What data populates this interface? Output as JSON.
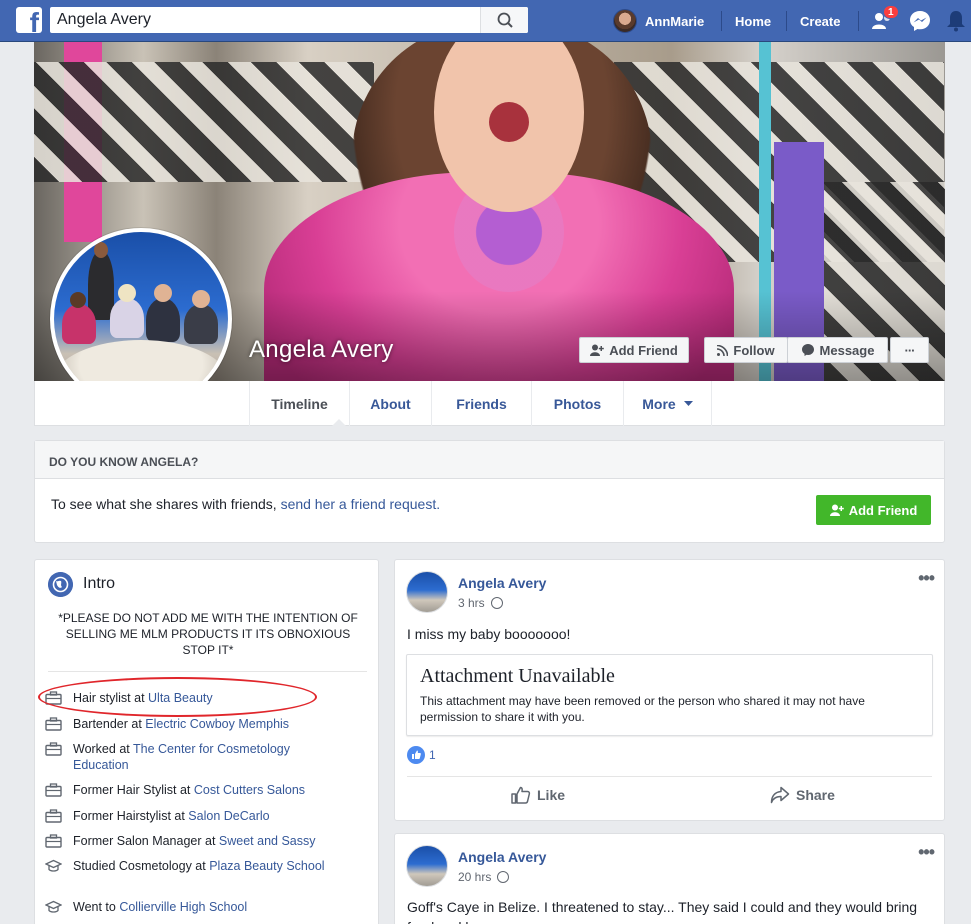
{
  "topbar": {
    "search_value": "Angela Avery",
    "user_name": "AnnMarie",
    "home": "Home",
    "create": "Create",
    "friend_requests_count": "1"
  },
  "profile": {
    "name": "Angela Avery",
    "buttons": {
      "add_friend": "Add Friend",
      "follow": "Follow",
      "message": "Message",
      "more": "···"
    },
    "tabs": [
      "Timeline",
      "About",
      "Friends",
      "Photos",
      "More"
    ]
  },
  "do_you_know": {
    "heading": "DO YOU KNOW ANGELA?",
    "text": "To see what she shares with friends, ",
    "link": "send her a friend request.",
    "button": "Add Friend"
  },
  "intro": {
    "title": "Intro",
    "bio": "*PLEASE DO NOT ADD ME WITH THE INTENTION OF SELLING ME MLM PRODUCTS IT ITS OBNOXIOUS STOP IT*",
    "items": [
      {
        "icon": "briefcase-icon",
        "prefix": "Hair stylist at ",
        "link": "Ulta Beauty"
      },
      {
        "icon": "briefcase-icon",
        "prefix": "Bartender at ",
        "link": "Electric Cowboy Memphis"
      },
      {
        "icon": "briefcase-icon",
        "prefix": "Worked at ",
        "link": "The Center for Cosmetology Education"
      },
      {
        "icon": "briefcase-icon",
        "prefix": "Former Hair Stylist at ",
        "link": "Cost Cutters Salons"
      },
      {
        "icon": "briefcase-icon",
        "prefix": "Former Hairstylist at ",
        "link": "Salon DeCarlo"
      },
      {
        "icon": "briefcase-icon",
        "prefix": "Former Salon Manager at ",
        "link": "Sweet and Sassy"
      },
      {
        "icon": "graduation-cap-icon",
        "prefix": "Studied Cosmetology at ",
        "link": "Plaza Beauty School"
      },
      {
        "icon": "graduation-cap-icon",
        "prefix": "Went to ",
        "link": "Collierville High School"
      }
    ]
  },
  "posts": [
    {
      "author": "Angela Avery",
      "time": "3 hrs",
      "text": "I miss my baby booooooo!",
      "attachment_title": "Attachment Unavailable",
      "attachment_body": "This attachment may have been removed or the person who shared it may not have permission to share it with you.",
      "likes": "1",
      "like_label": "Like",
      "share_label": "Share"
    },
    {
      "author": "Angela Avery",
      "time": "20 hrs",
      "text": "Goff's Caye in Belize. I threatened to stay... They said I could and they would bring food and beer."
    }
  ],
  "colors": {
    "brand": "#4267b2",
    "link": "#365899",
    "green": "#42b72a",
    "annotation": "#e0262b"
  }
}
